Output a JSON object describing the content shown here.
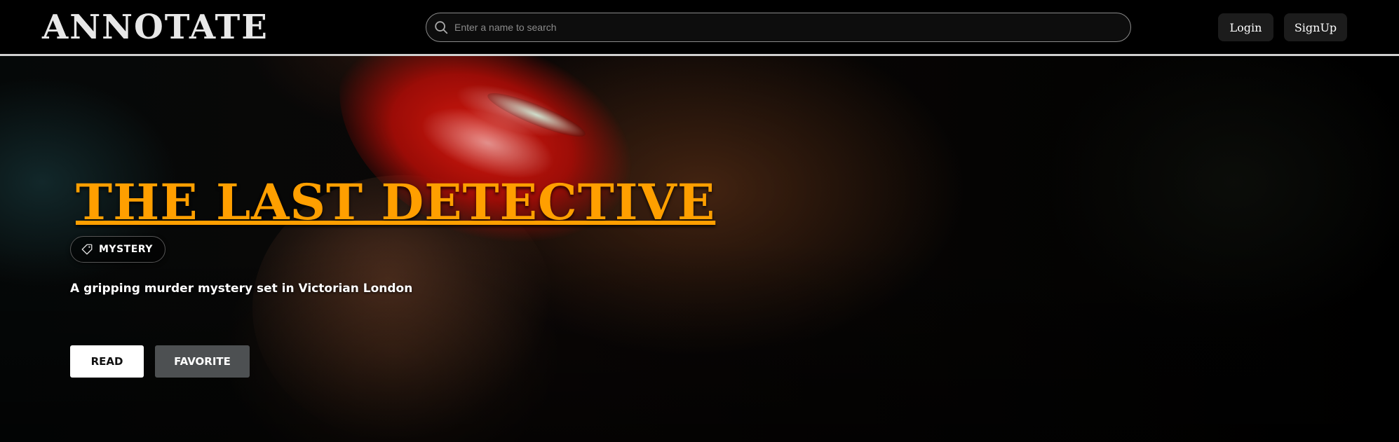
{
  "header": {
    "logo": "ANNOTATE",
    "search": {
      "placeholder": "Enter a name to search",
      "value": ""
    },
    "login_label": "Login",
    "signup_label": "SignUp"
  },
  "hero": {
    "title": "THE LAST DETECTIVE",
    "genre": "MYSTERY",
    "description": "A gripping murder mystery set in Victorian London",
    "read_label": "READ",
    "favorite_label": "FAVORITE"
  },
  "colors": {
    "title": "#ff9f00",
    "header_bg": "#000000",
    "header_border": "#d0d0d0",
    "read_bg": "#ffffff",
    "favorite_bg": "#4d5052"
  },
  "icons": {
    "search": "search-icon",
    "genre": "tag-icon"
  }
}
